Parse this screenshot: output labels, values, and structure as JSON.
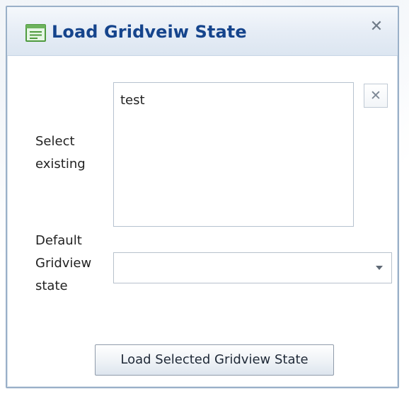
{
  "dialog": {
    "title": "Load Gridveiw State",
    "close_icon": "✕",
    "icon": "document-list-icon"
  },
  "form": {
    "select_existing_label": "Select\nexisting",
    "existing_items": [
      "test"
    ],
    "clear_icon": "✕",
    "default_label": "Default\nGridview\nstate",
    "default_value": ""
  },
  "actions": {
    "load_label": "Load Selected Gridview State"
  },
  "colors": {
    "title": "#15448c",
    "border": "#9ab0c8"
  }
}
